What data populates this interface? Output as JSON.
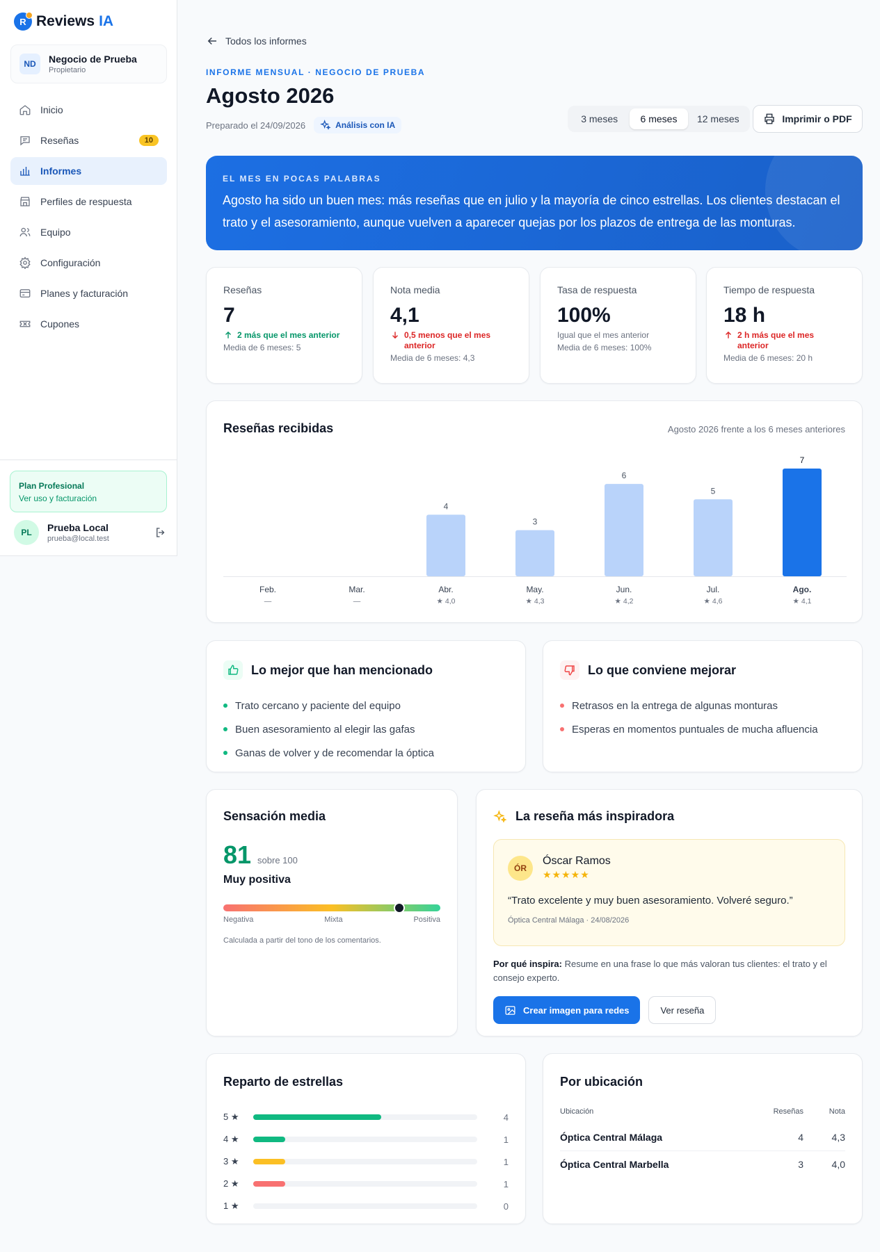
{
  "brand": {
    "name": "Reviews",
    "suffix": "IA",
    "mark": "R"
  },
  "business": {
    "initials": "ND",
    "name": "Negocio de Prueba",
    "role": "Propietario"
  },
  "nav": [
    {
      "label": "Inicio",
      "icon": "home-icon"
    },
    {
      "label": "Reseñas",
      "icon": "chat-icon",
      "badge": "10"
    },
    {
      "label": "Informes",
      "icon": "bar-chart-icon",
      "active": true
    },
    {
      "label": "Perfiles de respuesta",
      "icon": "store-icon"
    },
    {
      "label": "Equipo",
      "icon": "users-icon"
    },
    {
      "label": "Configuración",
      "icon": "gear-icon"
    },
    {
      "label": "Planes y facturación",
      "icon": "card-icon"
    },
    {
      "label": "Cupones",
      "icon": "ticket-icon"
    }
  ],
  "plan": {
    "title": "Plan Profesional",
    "link": "Ver uso y facturación"
  },
  "user": {
    "initials": "PL",
    "name": "Prueba Local",
    "email": "prueba@local.test"
  },
  "header": {
    "back": "Todos los informes",
    "eyebrow": "INFORME MENSUAL · NEGOCIO DE PRUEBA",
    "title": "Agosto 2026",
    "prepared": "Preparado el 24/09/2026",
    "ai_chip": "Análisis con IA",
    "ranges": [
      "3 meses",
      "6 meses",
      "12 meses"
    ],
    "selected_range": "6 meses",
    "print": "Imprimir o PDF"
  },
  "summary": {
    "label": "EL MES EN POCAS PALABRAS",
    "text": "Agosto ha sido un buen mes: más reseñas que en julio y la mayoría de cinco estrellas. Los clientes destacan el trato y el asesoramiento, aunque vuelven a aparecer quejas por los plazos de entrega de las monturas."
  },
  "kpis": [
    {
      "label": "Reseñas",
      "value": "7",
      "delta": "2 más que el mes anterior",
      "trend": "up-good",
      "avg": "Media de 6 meses: 5"
    },
    {
      "label": "Nota media",
      "value": "4,1",
      "delta": "0,5 menos que el mes anterior",
      "trend": "down-bad",
      "avg": "Media de 6 meses: 4,3"
    },
    {
      "label": "Tasa de respuesta",
      "value": "100%",
      "delta": "Igual que el mes anterior",
      "trend": "flat",
      "avg": "Media de 6 meses: 100%"
    },
    {
      "label": "Tiempo de respuesta",
      "value": "18 h",
      "delta": "2 h más que el mes anterior",
      "trend": "up-bad",
      "avg": "Media de 6 meses: 20 h"
    }
  ],
  "chart": {
    "title": "Reseñas recibidas",
    "subtitle": "Agosto 2026 frente a los 6 meses anteriores"
  },
  "chart_data": {
    "type": "bar",
    "categories": [
      "Feb.",
      "Mar.",
      "Abr.",
      "May.",
      "Jun.",
      "Jul.",
      "Ago."
    ],
    "values": [
      null,
      null,
      4,
      3,
      6,
      5,
      7
    ],
    "ratings": [
      "—",
      "—",
      "★ 4,0",
      "★ 4,3",
      "★ 4,2",
      "★ 4,6",
      "★ 4,1"
    ],
    "highlight": "Ago.",
    "ylim": [
      0,
      7
    ],
    "colors": {
      "bar": "#b9d3fa",
      "current": "#1a73e8"
    }
  },
  "best": {
    "title": "Lo mejor que han mencionado",
    "items": [
      "Trato cercano y paciente del equipo",
      "Buen asesoramiento al elegir las gafas",
      "Ganas de volver y de recomendar la óptica"
    ]
  },
  "improve": {
    "title": "Lo que conviene mejorar",
    "items": [
      "Retrasos en la entrega de algunas monturas",
      "Esperas en momentos puntuales de mucha afluencia"
    ]
  },
  "sentiment": {
    "title": "Sensación media",
    "score": "81",
    "out_of": "sobre 100",
    "word": "Muy positiva",
    "level": 81,
    "labels": [
      "Negativa",
      "Mixta",
      "Positiva"
    ],
    "note": "Calculada a partir del tono de los comentarios."
  },
  "inspiring": {
    "title": "La reseña más inspiradora",
    "initials": "ÓR",
    "author": "Óscar Ramos",
    "stars": "★★★★★",
    "quote": "“Trato excelente y muy buen asesoramiento. Volveré seguro.”",
    "meta": "Óptica Central Málaga · 24/08/2026",
    "why_label": "Por qué inspira:",
    "why_text": " Resume en una frase lo que más valoran tus clientes: el trato y el consejo experto.",
    "cta": "Crear imagen para redes",
    "secondary": "Ver reseña"
  },
  "distribution": {
    "title": "Reparto de estrellas",
    "rows": [
      {
        "label": "5 ★",
        "count": 4,
        "color": "#10b981"
      },
      {
        "label": "4 ★",
        "count": 1,
        "color": "#10b981"
      },
      {
        "label": "3 ★",
        "count": 1,
        "color": "#fbbf24"
      },
      {
        "label": "2 ★",
        "count": 1,
        "color": "#f87171"
      },
      {
        "label": "1 ★",
        "count": 0,
        "color": "#f87171"
      }
    ]
  },
  "locations": {
    "title": "Por ubicación",
    "headers": [
      "Ubicación",
      "Reseñas",
      "Nota"
    ],
    "rows": [
      {
        "name": "Óptica Central Málaga",
        "reviews": "4",
        "rating": "4,3"
      },
      {
        "name": "Óptica Central Marbella",
        "reviews": "3",
        "rating": "4,0"
      }
    ]
  }
}
